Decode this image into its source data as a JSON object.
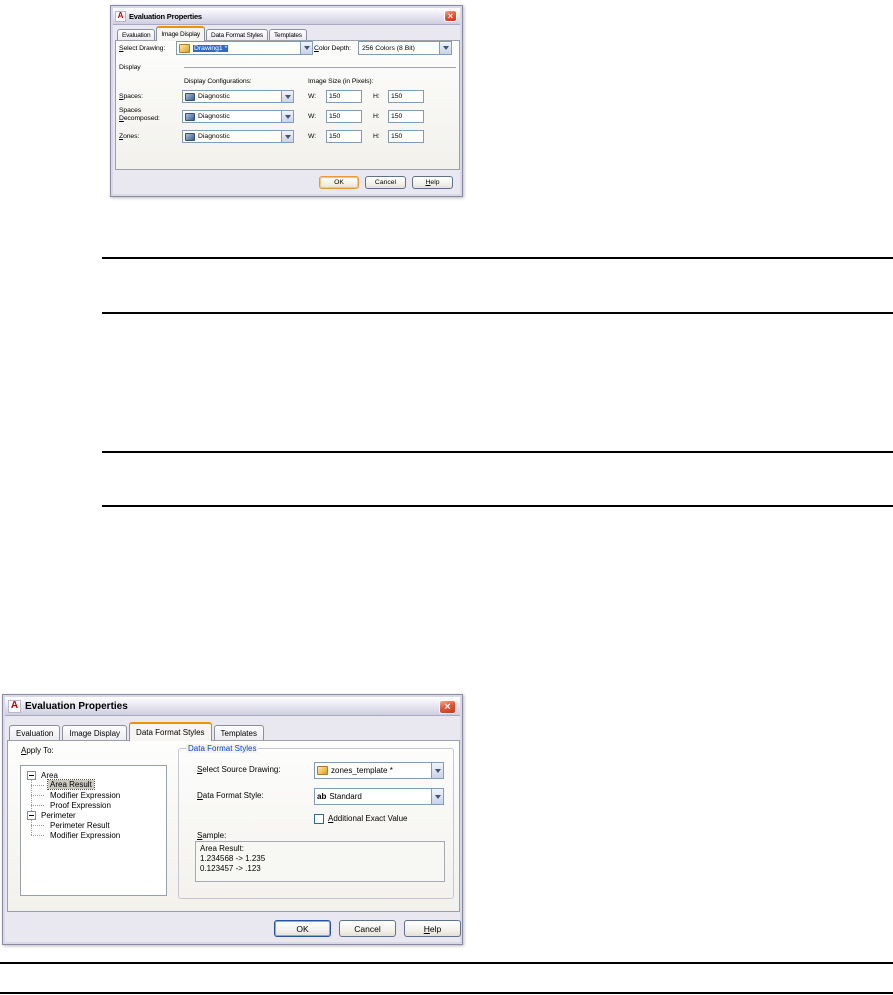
{
  "icons": {
    "app_letter": "A",
    "close": "×"
  },
  "colors": {
    "active_tab_accent": "#e5940e",
    "selection_blue": "#316ac5",
    "group_label_blue": "#0046d5",
    "close_button_red": "#d54a28"
  },
  "dialog_image_display": {
    "title": "Evaluation Properties",
    "tabs": [
      {
        "label": "Evaluation",
        "active": false
      },
      {
        "label": "Image Display",
        "active": true
      },
      {
        "label": "Data Format Styles",
        "active": false
      },
      {
        "label": "Templates",
        "active": false
      }
    ],
    "select_drawing_label_ak": "S",
    "select_drawing_label_rest": "elect Drawing:",
    "select_drawing_value": "Drawing1 *",
    "color_depth_label_ak": "C",
    "color_depth_label_rest": "olor Depth:",
    "color_depth_value": "256 Colors (8 Bit)",
    "display_label": "Display",
    "display_config_header": "Display Configurations:",
    "image_size_header": "Image Size (in Pixels):",
    "w_label": "W:",
    "h_label": "H:",
    "rows": [
      {
        "label_ak": "S",
        "label_rest": "paces:",
        "config": "Diagnostic",
        "w": "150",
        "h": "150"
      },
      {
        "label_line1": "Spaces",
        "label_ak": "D",
        "label_rest": "ecomposed:",
        "config": "Diagnostic",
        "w": "150",
        "h": "150"
      },
      {
        "label_ak": "Z",
        "label_rest": "ones:",
        "config": "Diagnostic",
        "w": "150",
        "h": "150"
      }
    ],
    "ok": "OK",
    "cancel": "Cancel",
    "help_ak": "H",
    "help_rest": "elp"
  },
  "dialog_data_format": {
    "title": "Evaluation Properties",
    "tabs": [
      {
        "label": "Evaluation",
        "active": false
      },
      {
        "label": "Image Display",
        "active": false
      },
      {
        "label": "Data Format Styles",
        "active": true
      },
      {
        "label": "Templates",
        "active": false
      }
    ],
    "apply_to_ak": "A",
    "apply_to_rest": "pply To:",
    "tree": {
      "area": "Area",
      "area_children": [
        "Area Result",
        "Modifier Expression",
        "Proof Expression"
      ],
      "perimeter": "Perimeter",
      "perimeter_children": [
        "Perimeter Result",
        "Modifier Expression"
      ]
    },
    "group_label": "Data Format Styles",
    "source_drawing_label_ak": "S",
    "source_drawing_label_rest": "elect Source Drawing:",
    "source_drawing_value": "zones_template *",
    "format_style_label_ak": "D",
    "format_style_label_rest": "ata Format Style:",
    "format_style_icon": "ab",
    "format_style_value": "Standard",
    "additional_exact_ak": "A",
    "additional_exact_rest": "dditional Exact Value",
    "sample_label_ak": "S",
    "sample_label_rest": "ample:",
    "sample_lines": [
      "Area Result:",
      "1.234568 -> 1.235",
      "0.123457 -> .123"
    ],
    "ok": "OK",
    "cancel": "Cancel",
    "help_ak": "H",
    "help_rest": "elp"
  }
}
